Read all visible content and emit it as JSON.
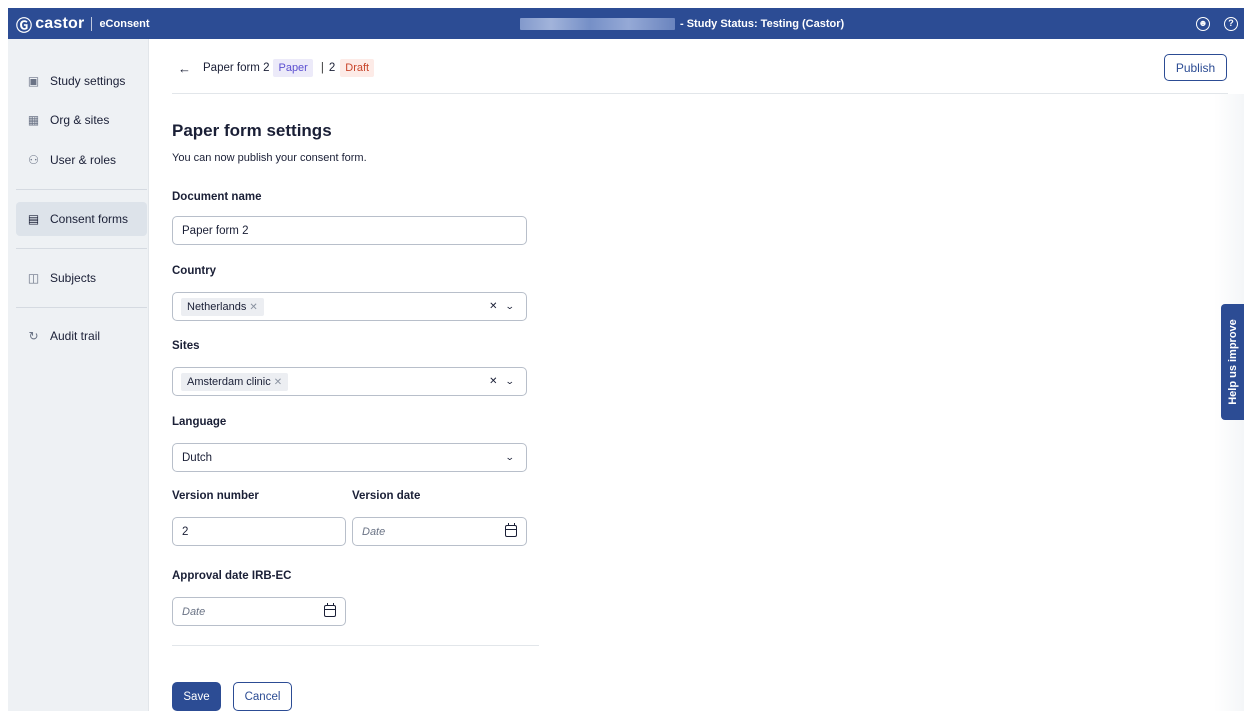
{
  "app": {
    "brand": "castor",
    "product": "eConsent",
    "study_status": "- Study Status: Testing (Castor)"
  },
  "topbar": {
    "icons": [
      "user-circle-icon",
      "help-circle-icon"
    ]
  },
  "sidebar": {
    "items": [
      {
        "label": "Study settings",
        "icon": "book-icon"
      },
      {
        "label": "Org & sites",
        "icon": "building-icon"
      },
      {
        "label": "User & roles",
        "icon": "users-icon"
      },
      {
        "label": "Consent forms",
        "icon": "clipboard-icon",
        "active": true
      },
      {
        "label": "Subjects",
        "icon": "subjects-icon"
      },
      {
        "label": "Audit trail",
        "icon": "history-icon"
      }
    ]
  },
  "breadcrumb": {
    "form_name": "Paper form 2",
    "type_badge": "Paper",
    "separator": "|",
    "version": "2",
    "status_badge": "Draft"
  },
  "header": {
    "publish_label": "Publish"
  },
  "form": {
    "title": "Paper form settings",
    "subtitle": "You can now publish your consent form.",
    "document_name": {
      "label": "Document name",
      "value": "Paper form 2"
    },
    "country": {
      "label": "Country",
      "selected": "Netherlands"
    },
    "sites": {
      "label": "Sites",
      "selected": "Amsterdam clinic"
    },
    "language": {
      "label": "Language",
      "value": "Dutch"
    },
    "version_number": {
      "label": "Version number",
      "value": "2"
    },
    "version_date": {
      "label": "Version date",
      "placeholder": "Date"
    },
    "approval_date": {
      "label": "Approval date IRB-EC",
      "placeholder": "Date"
    },
    "save_label": "Save",
    "cancel_label": "Cancel"
  },
  "feedback": {
    "label": "Help us improve"
  },
  "colors": {
    "primary": "#2c4c94",
    "paper_badge": "#5b4fd1",
    "draft_badge": "#c8442a"
  }
}
